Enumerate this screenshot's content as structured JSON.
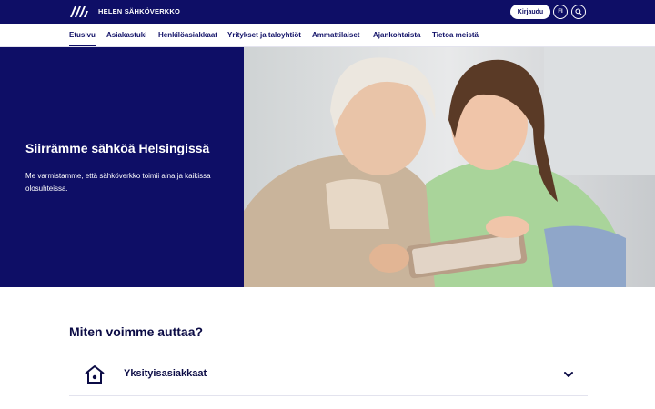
{
  "header": {
    "brand": "HELEN SÄHKÖVERKKO",
    "login_label": "Kirjaudu",
    "language_label": "FI",
    "icons": {
      "logo": "helen-logo-icon",
      "search": "search-icon"
    }
  },
  "nav": {
    "items": [
      {
        "label": "Etusivu",
        "active": true
      },
      {
        "label": "Asiakastuki"
      },
      {
        "label": "Henkilöasiakkaat"
      },
      {
        "label": "Yritykset ja taloyhtiöt"
      },
      {
        "label": "Ammattilaiset"
      },
      {
        "label": "Ajankohtaista"
      },
      {
        "label": "Tietoa meistä"
      }
    ]
  },
  "hero": {
    "title": "Siirrämme sähköä Helsingissä",
    "text": "Me varmistamme, että sähköverkko toimii aina ja kaikissa olosuhteissa."
  },
  "help": {
    "title": "Miten voimme auttaa?",
    "accordion": [
      {
        "label": "Yksityisasiakkaat",
        "icon": "house-icon",
        "toggle_icon": "chevron-down-icon"
      }
    ]
  },
  "colors": {
    "brand": "#0e0e66",
    "background": "#ffffff"
  }
}
